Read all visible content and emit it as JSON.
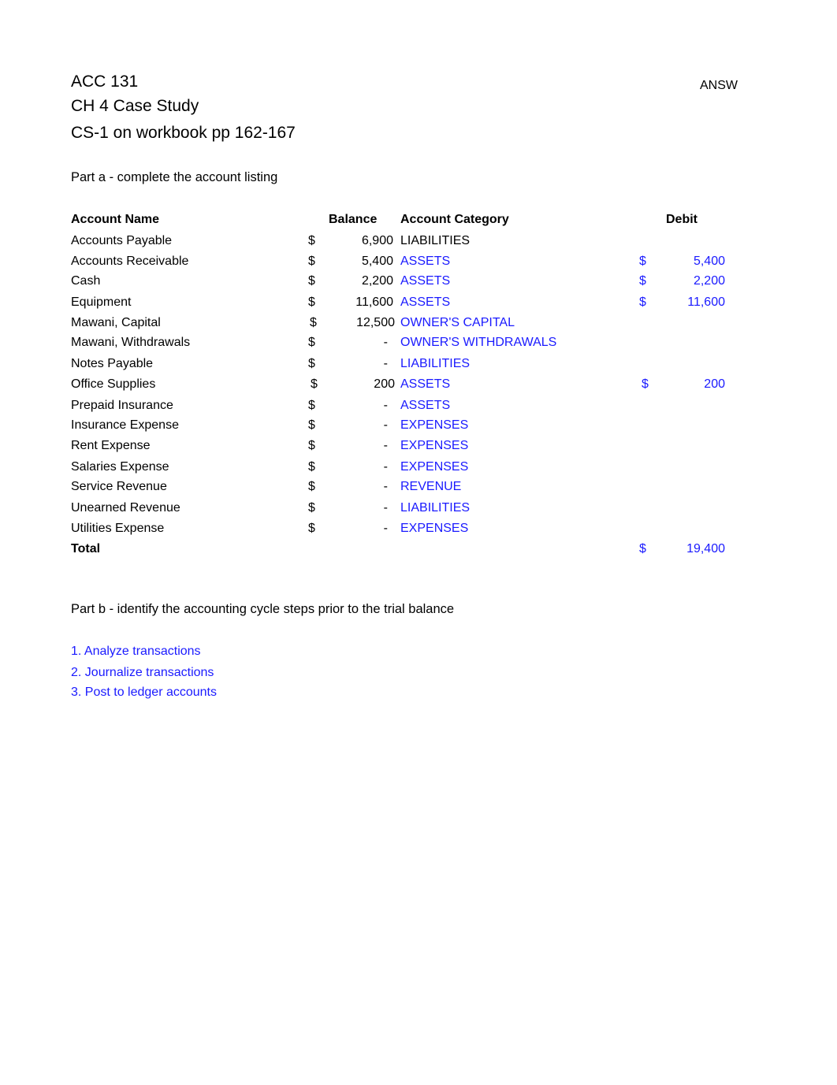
{
  "header": {
    "course": "ACC 131",
    "chapter": "CH 4 Case Study",
    "assignment": "CS-1 on workbook pp 162-167",
    "answer_tag": "ANSW"
  },
  "part_a": {
    "title": "Part a - complete the account listing",
    "columns": {
      "account_name": "Account Name",
      "balance": "Balance",
      "account_category": "Account Category",
      "debit": "Debit"
    },
    "rows": [
      {
        "name": "Accounts Payable",
        "balance_currency": "$",
        "balance": "6,900",
        "category": "LIABILITIES",
        "category_color": "black",
        "debit_currency": "",
        "debit": ""
      },
      {
        "name": "Accounts Receivable",
        "balance_currency": "$",
        "balance": "5,400",
        "category": "ASSETS",
        "category_color": "blue",
        "debit_currency": "$",
        "debit": "5,400"
      },
      {
        "name": "Cash",
        "balance_currency": "$",
        "balance": "2,200",
        "category": "ASSETS",
        "category_color": "blue",
        "debit_currency": "$",
        "debit": "2,200"
      },
      {
        "name": "Equipment",
        "balance_currency": "$",
        "balance": "11,600",
        "category": "ASSETS",
        "category_color": "blue",
        "debit_currency": "$",
        "debit": "11,600"
      },
      {
        "name": "Mawani, Capital",
        "balance_currency": "$",
        "balance": "12,500",
        "category": "OWNER'S CAPITAL",
        "category_color": "blue",
        "debit_currency": "",
        "debit": ""
      },
      {
        "name": "Mawani, Withdrawals",
        "balance_currency": "$",
        "balance": "-",
        "category": "OWNER'S WITHDRAWALS",
        "category_color": "blue",
        "debit_currency": "",
        "debit": ""
      },
      {
        "name": "Notes Payable",
        "balance_currency": "$",
        "balance": "-",
        "category": "LIABILITIES",
        "category_color": "blue",
        "debit_currency": "",
        "debit": ""
      },
      {
        "name": "Office Supplies",
        "balance_currency": "$",
        "balance": "200",
        "category": "ASSETS",
        "category_color": "blue",
        "debit_currency": "$",
        "debit": "200"
      },
      {
        "name": "Prepaid Insurance",
        "balance_currency": "$",
        "balance": "-",
        "category": "ASSETS",
        "category_color": "blue",
        "debit_currency": "",
        "debit": ""
      },
      {
        "name": "Insurance Expense",
        "balance_currency": "$",
        "balance": "-",
        "category": "EXPENSES",
        "category_color": "blue",
        "debit_currency": "",
        "debit": ""
      },
      {
        "name": "Rent Expense",
        "balance_currency": "$",
        "balance": "-",
        "category": "EXPENSES",
        "category_color": "blue",
        "debit_currency": "",
        "debit": ""
      },
      {
        "name": "Salaries Expense",
        "balance_currency": "$",
        "balance": "-",
        "category": "EXPENSES",
        "category_color": "blue",
        "debit_currency": "",
        "debit": ""
      },
      {
        "name": "Service Revenue",
        "balance_currency": "$",
        "balance": "-",
        "category": "REVENUE",
        "category_color": "blue",
        "debit_currency": "",
        "debit": ""
      },
      {
        "name": "Unearned Revenue",
        "balance_currency": "$",
        "balance": "-",
        "category": "LIABILITIES",
        "category_color": "blue",
        "debit_currency": "",
        "debit": ""
      },
      {
        "name": "Utilities Expense",
        "balance_currency": "$",
        "balance": "-",
        "category": "EXPENSES",
        "category_color": "blue",
        "debit_currency": "",
        "debit": ""
      }
    ],
    "total": {
      "label": "Total",
      "debit_currency": "$",
      "debit": "19,400"
    }
  },
  "part_b": {
    "title": "Part b - identify the accounting cycle steps prior to the trial balance",
    "steps": [
      "1.  Analyze transactions",
      "2.  Journalize transactions",
      "3.  Post to ledger accounts"
    ]
  },
  "colors": {
    "answer_blue": "#1a1aff",
    "text_black": "#000000"
  }
}
